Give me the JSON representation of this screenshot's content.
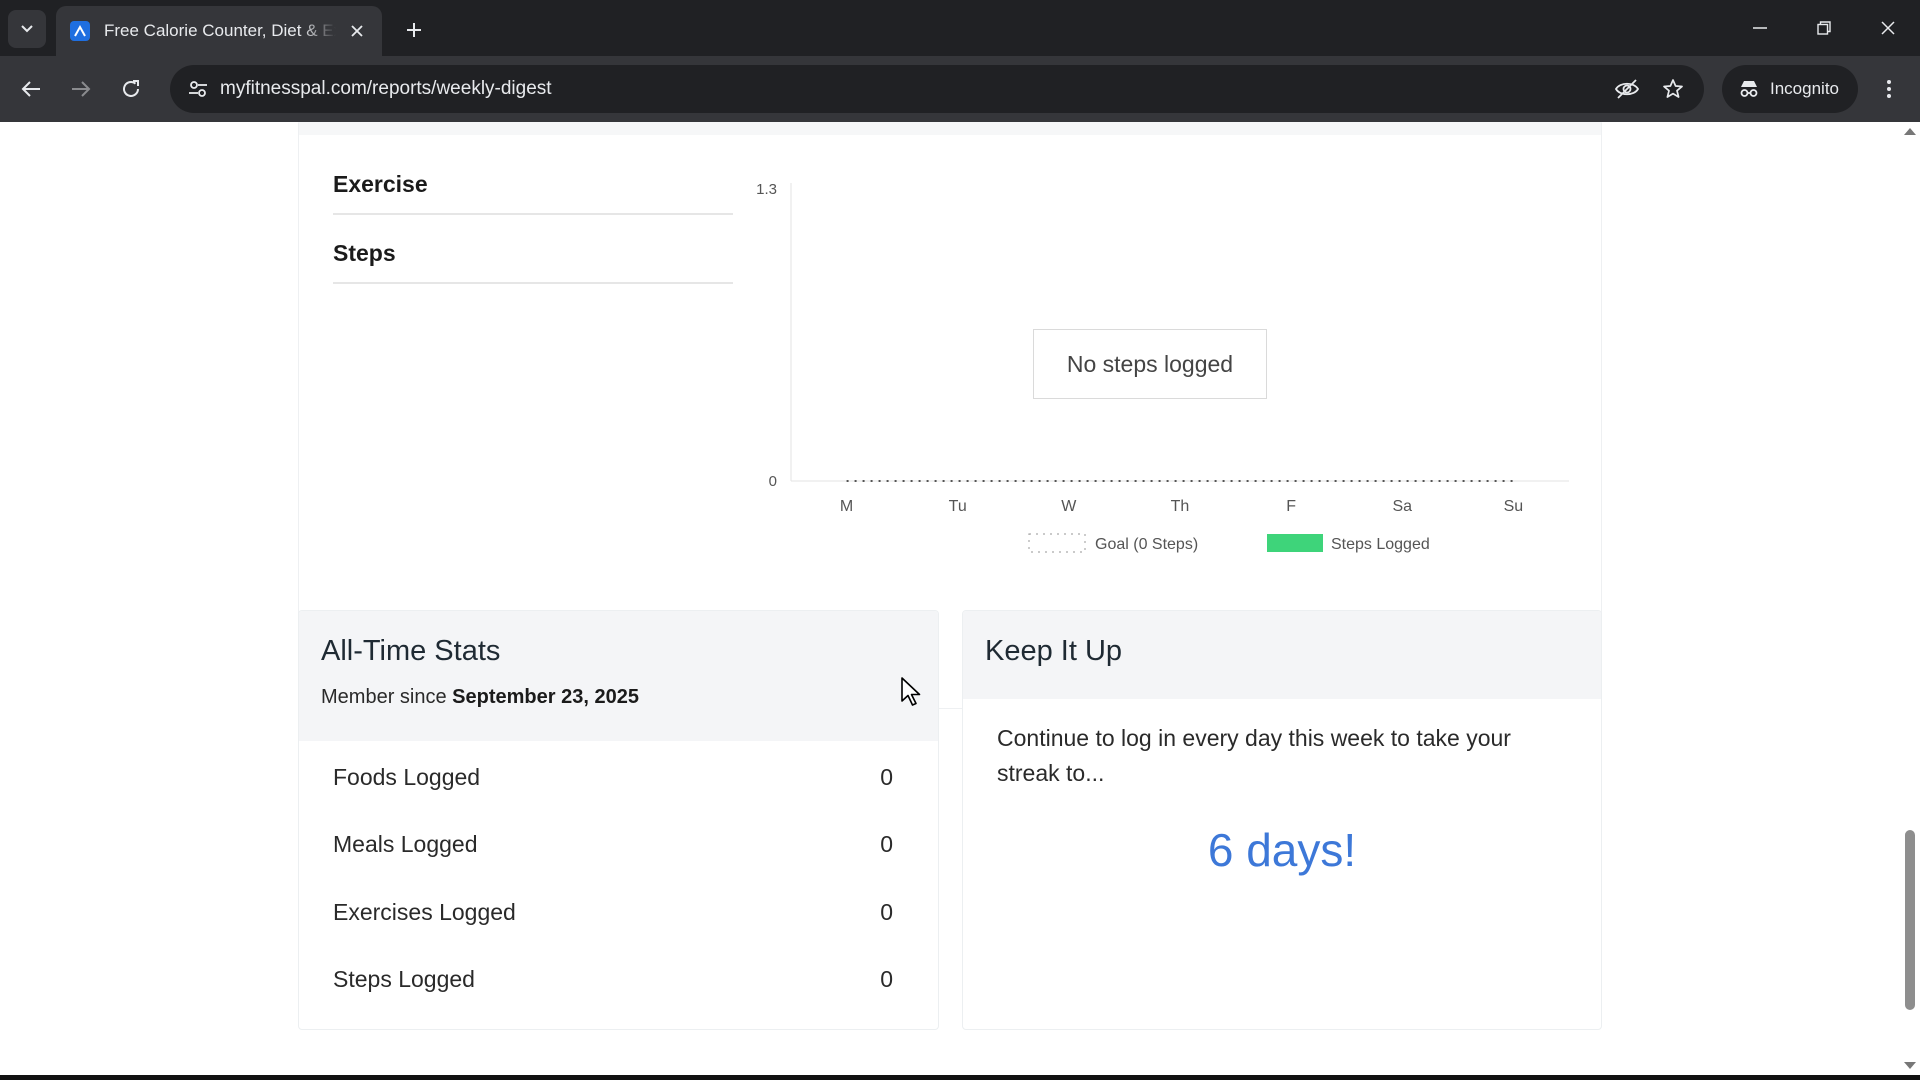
{
  "browser": {
    "tab_title": "Free Calorie Counter, Diet & Exercise",
    "url": "myfitnesspal.com/reports/weekly-digest",
    "incognito_label": "Incognito"
  },
  "report": {
    "sidebar": [
      "Exercise",
      "Steps"
    ],
    "chart_message": "No steps logged"
  },
  "chart_data": {
    "type": "bar",
    "categories": [
      "M",
      "Tu",
      "W",
      "Th",
      "F",
      "Sa",
      "Su"
    ],
    "series": [
      {
        "name": "Steps Logged",
        "values": [
          0,
          0,
          0,
          0,
          0,
          0,
          0
        ],
        "color": "#3ed47a"
      }
    ],
    "goal": {
      "name": "Goal (0 Steps)",
      "values": [
        0,
        0,
        0,
        0,
        0,
        0,
        0
      ]
    },
    "ylim": [
      0,
      1.3
    ],
    "yticks": [
      "0",
      "1.3"
    ],
    "legend_position": "bottom",
    "grid": false
  },
  "all_time_stats": {
    "title": "All-Time Stats",
    "member_since_label": "Member since",
    "member_since_date": "September 23, 2025",
    "rows": [
      {
        "label": "Foods Logged",
        "value": "0"
      },
      {
        "label": "Meals Logged",
        "value": "0"
      },
      {
        "label": "Exercises Logged",
        "value": "0"
      },
      {
        "label": "Steps Logged",
        "value": "0"
      }
    ]
  },
  "keep_it_up": {
    "title": "Keep It Up",
    "message": "Continue to log in every day this week to take your streak to...",
    "streak": "6 days!"
  },
  "colors": {
    "accent_blue": "#3d78d8",
    "steps_green": "#3ed47a"
  }
}
